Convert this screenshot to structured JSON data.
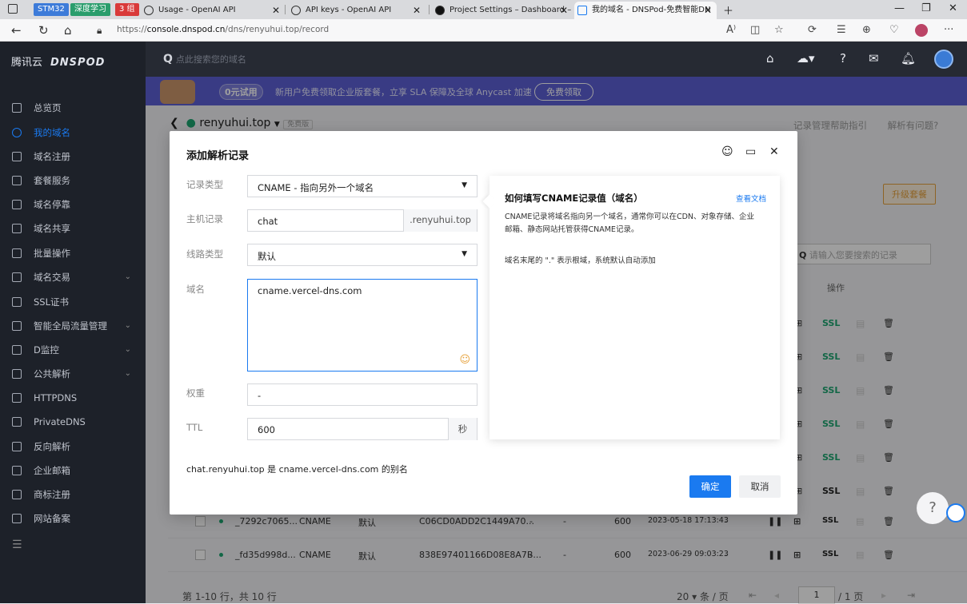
{
  "browser": {
    "pills": [
      {
        "label": "STM32",
        "color": "#3d7bd9"
      },
      {
        "label": "深度学习",
        "color": "#2a9d6c"
      },
      {
        "label": "3 组",
        "color": "#d93a3a"
      }
    ],
    "tabs": [
      {
        "title": "Usage - OpenAI API"
      },
      {
        "title": "API keys - OpenAI API"
      },
      {
        "title": "Project Settings – Dashboard – V"
      },
      {
        "title": "我的域名 - DNSPod-免费智能DN"
      }
    ],
    "url_prefix": "https://",
    "url_host": "console.dnspod.cn",
    "url_path": "/dns/renyuhui.top/record"
  },
  "sidebar": {
    "logo_left": "腾讯云",
    "logo_right": "DNSPOD",
    "items": [
      {
        "label": "总览页"
      },
      {
        "label": "我的域名"
      },
      {
        "label": "域名注册"
      },
      {
        "label": "套餐服务"
      },
      {
        "label": "域名停靠"
      },
      {
        "label": "域名共享"
      },
      {
        "label": "批量操作"
      },
      {
        "label": "域名交易"
      },
      {
        "label": "SSL证书"
      },
      {
        "label": "智能全局流量管理"
      },
      {
        "label": "D监控"
      },
      {
        "label": "公共解析"
      },
      {
        "label": "HTTPDNS"
      },
      {
        "label": "PrivateDNS"
      },
      {
        "label": "反向解析"
      },
      {
        "label": "企业邮箱"
      },
      {
        "label": "商标注册"
      },
      {
        "label": "网站备案"
      }
    ]
  },
  "topbar": {
    "search_placeholder": "点此搜索您的域名"
  },
  "banner": {
    "tag": "0元试用",
    "text": "新用户免费领取企业版套餐，立享 SLA 保障及全球 Anycast 加速",
    "button": "免费领取"
  },
  "page": {
    "domain": "renyuhui.top",
    "plan_badge": "免费版",
    "help_link_1": "记录管理帮助指引",
    "help_link_2": "解析有问题?",
    "upgrade": "升级套餐",
    "record_search_placeholder": "请输入您要搜索的记录",
    "ops_header": "操作",
    "ssl_label": "SSL",
    "rows": [
      {
        "host": "_7292c7065...",
        "type": "CNAME",
        "line": "默认",
        "value": "C06CD0ADD2C1449A70...",
        "w": "-",
        "mx": "-",
        "ttl": "600",
        "time": "2023-05-18 17:13:43",
        "status": "-"
      },
      {
        "host": "_fd35d998d...",
        "type": "CNAME",
        "line": "默认",
        "value": "838E97401166D08E8A7B...",
        "w": "-",
        "mx": "-",
        "ttl": "600",
        "time": "2023-06-29 09:03:23",
        "status": "-"
      }
    ],
    "pagination_summary": "第 1-10 行，共 10 行",
    "page_size": "20",
    "page_size_unit": "条 / 页",
    "page_current": "1",
    "page_total": "/ 1 页"
  },
  "modal": {
    "title": "添加解析记录",
    "fields": {
      "record_type": {
        "label": "记录类型",
        "value": "CNAME - 指向另外一个域名"
      },
      "host": {
        "label": "主机记录",
        "value": "chat",
        "suffix": ".renyuhui.top"
      },
      "line": {
        "label": "线路类型",
        "value": "默认"
      },
      "value": {
        "label": "域名",
        "value": "cname.vercel-dns.com"
      },
      "weight": {
        "label": "权重",
        "value": "-"
      },
      "ttl": {
        "label": "TTL",
        "value": "600",
        "unit": "秒"
      }
    },
    "alias_text": "chat.renyuhui.top  是  cname.vercel-dns.com 的别名",
    "confirm": "确定",
    "cancel": "取消",
    "help": {
      "title": "如何填写CNAME记录值（域名）",
      "doc_link": "查看文档",
      "body": "CNAME记录将域名指向另一个域名，通常你可以在CDN、对象存储、企业邮箱、静态网站托管获得CNAME记录。",
      "note": "域名末尾的 \".\" 表示根域，系统默认自动添加"
    }
  }
}
